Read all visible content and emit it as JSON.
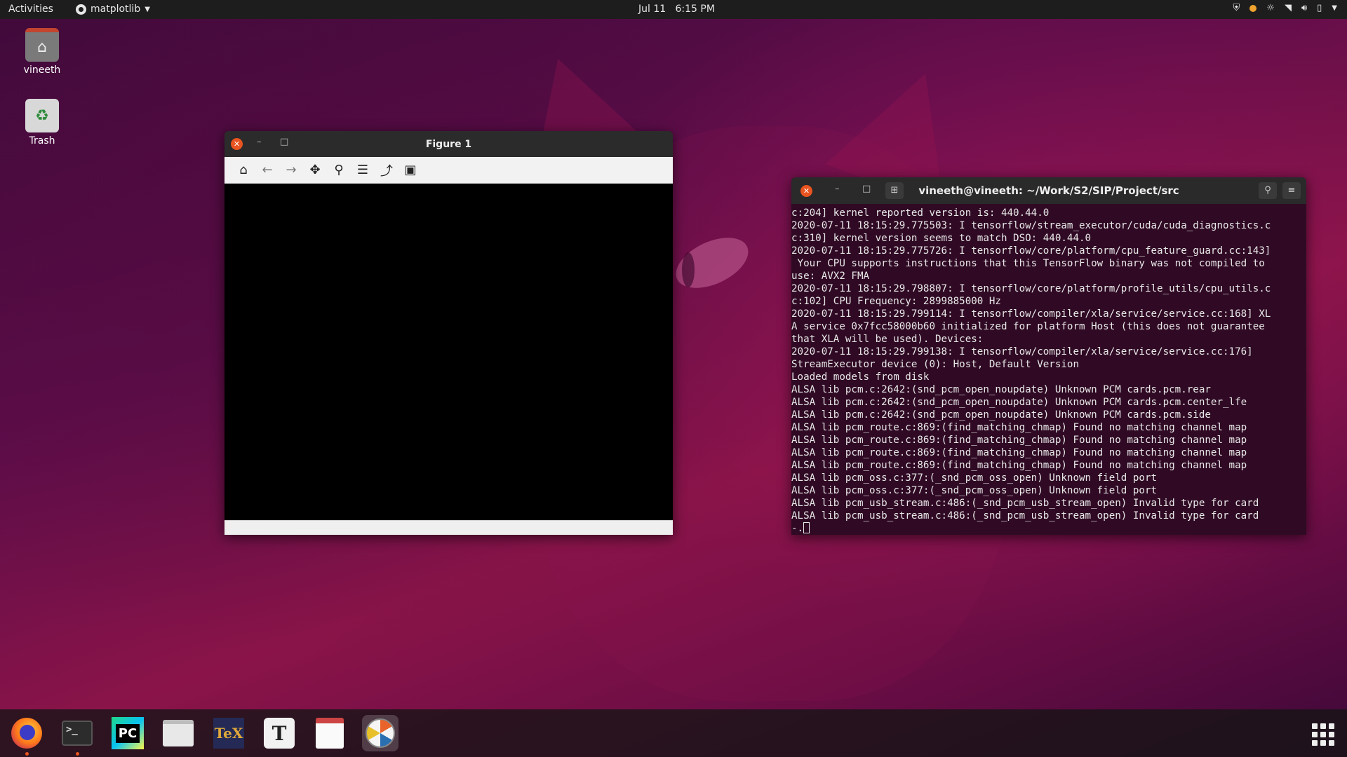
{
  "topbar": {
    "activities": "Activities",
    "app_menu": "matplotlib",
    "clock": "Jul 11   6:15 PM"
  },
  "desktop": {
    "icons": [
      {
        "label": "vineeth",
        "icon": "home-folder-icon"
      },
      {
        "label": "Trash",
        "icon": "trash-icon"
      }
    ]
  },
  "figure_window": {
    "title": "Figure 1",
    "toolbar": [
      "home-icon",
      "back-arrow-icon",
      "forward-arrow-icon",
      "pan-icon",
      "zoom-icon",
      "configure-subplots-icon",
      "edit-axes-icon",
      "save-icon"
    ]
  },
  "terminal": {
    "title": "vineeth@vineeth: ~/Work/S2/SIP/Project/src",
    "lines": [
      "c:204] kernel reported version is: 440.44.0",
      "2020-07-11 18:15:29.775503: I tensorflow/stream_executor/cuda/cuda_diagnostics.c",
      "c:310] kernel version seems to match DSO: 440.44.0",
      "2020-07-11 18:15:29.775726: I tensorflow/core/platform/cpu_feature_guard.cc:143]",
      " Your CPU supports instructions that this TensorFlow binary was not compiled to",
      "use: AVX2 FMA",
      "2020-07-11 18:15:29.798807: I tensorflow/core/platform/profile_utils/cpu_utils.c",
      "c:102] CPU Frequency: 2899885000 Hz",
      "2020-07-11 18:15:29.799114: I tensorflow/compiler/xla/service/service.cc:168] XL",
      "A service 0x7fcc58000b60 initialized for platform Host (this does not guarantee",
      "that XLA will be used). Devices:",
      "2020-07-11 18:15:29.799138: I tensorflow/compiler/xla/service/service.cc:176]",
      "StreamExecutor device (0): Host, Default Version",
      "Loaded models from disk",
      "ALSA lib pcm.c:2642:(snd_pcm_open_noupdate) Unknown PCM cards.pcm.rear",
      "ALSA lib pcm.c:2642:(snd_pcm_open_noupdate) Unknown PCM cards.pcm.center_lfe",
      "ALSA lib pcm.c:2642:(snd_pcm_open_noupdate) Unknown PCM cards.pcm.side",
      "ALSA lib pcm_route.c:869:(find_matching_chmap) Found no matching channel map",
      "ALSA lib pcm_route.c:869:(find_matching_chmap) Found no matching channel map",
      "ALSA lib pcm_route.c:869:(find_matching_chmap) Found no matching channel map",
      "ALSA lib pcm_route.c:869:(find_matching_chmap) Found no matching channel map",
      "ALSA lib pcm_oss.c:377:(_snd_pcm_oss_open) Unknown field port",
      "ALSA lib pcm_oss.c:377:(_snd_pcm_oss_open) Unknown field port",
      "ALSA lib pcm_usb_stream.c:486:(_snd_pcm_usb_stream_open) Invalid type for card",
      "ALSA lib pcm_usb_stream.c:486:(_snd_pcm_usb_stream_open) Invalid type for card"
    ],
    "prompt": "-."
  },
  "dock": {
    "items": [
      {
        "name": "firefox",
        "icon": "firefox-icon"
      },
      {
        "name": "terminal",
        "icon": "terminal-icon",
        "glyph": ">_"
      },
      {
        "name": "pycharm",
        "icon": "pycharm-icon",
        "glyph": "PC"
      },
      {
        "name": "files",
        "icon": "files-icon"
      },
      {
        "name": "texstudio",
        "icon": "tex-icon",
        "glyph": "TeX"
      },
      {
        "name": "typora",
        "icon": "typora-icon",
        "glyph": "T"
      },
      {
        "name": "document-viewer",
        "icon": "document-viewer-icon"
      },
      {
        "name": "matplotlib",
        "icon": "matplotlib-icon"
      }
    ]
  },
  "colors": {
    "accent": "#e95420",
    "terminal_bg": "#300a24",
    "topbar_bg": "#1d1d1d"
  }
}
